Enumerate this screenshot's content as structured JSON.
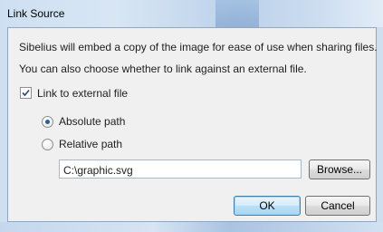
{
  "window": {
    "title": "Link Source"
  },
  "description": {
    "line1": "Sibelius will embed a copy of the image for ease of use when sharing files.",
    "line2": "You can also choose whether to link against an external file."
  },
  "link_option": {
    "label": "Link to external file",
    "checked": true
  },
  "path_mode": {
    "options": [
      {
        "label": "Absolute path",
        "selected": true
      },
      {
        "label": "Relative path",
        "selected": false
      }
    ]
  },
  "path_field": {
    "value": "C:\\graphic.svg"
  },
  "buttons": {
    "browse": "Browse...",
    "ok": "OK",
    "cancel": "Cancel"
  },
  "icons": {
    "checkbox_mark": "check-icon",
    "radio_selected": "radio-dot-icon"
  },
  "colors": {
    "accent": "#3c7fb1",
    "dialog_bg": "#f0f0f0",
    "frame": "#cfdff0"
  }
}
